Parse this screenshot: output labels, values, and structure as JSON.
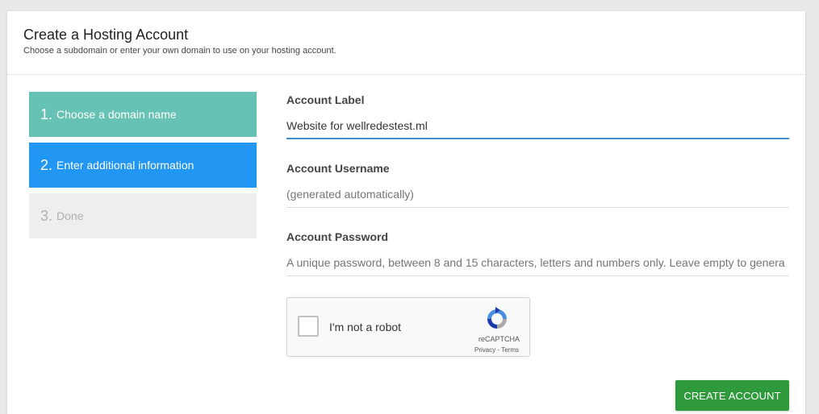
{
  "header": {
    "title": "Create a Hosting Account",
    "subtitle": "Choose a subdomain or enter your own domain to use on your hosting account."
  },
  "steps": [
    {
      "number": "1.",
      "label": "Choose a domain name",
      "state": "completed"
    },
    {
      "number": "2.",
      "label": "Enter additional information",
      "state": "active"
    },
    {
      "number": "3.",
      "label": "Done",
      "state": "pending"
    }
  ],
  "form": {
    "account_label": {
      "label": "Account Label",
      "value": "Website for wellredestest.ml"
    },
    "account_username": {
      "label": "Account Username",
      "placeholder": "(generated automatically)"
    },
    "account_password": {
      "label": "Account Password",
      "placeholder": "A unique password, between 8 and 15 characters, letters and numbers only. Leave empty to genera"
    }
  },
  "recaptcha": {
    "label": "I'm not a robot",
    "brand": "reCAPTCHA",
    "links": "Privacy - Terms",
    "logo_icon": "recaptcha-logo-icon"
  },
  "actions": {
    "create_label": "CREATE ACCOUNT"
  },
  "colors": {
    "step_completed": "#66c2b4",
    "step_active": "#2196f3",
    "step_pending": "#eeeeee",
    "primary_button": "#2e9a3b",
    "input_focus": "#3f8fd6"
  }
}
